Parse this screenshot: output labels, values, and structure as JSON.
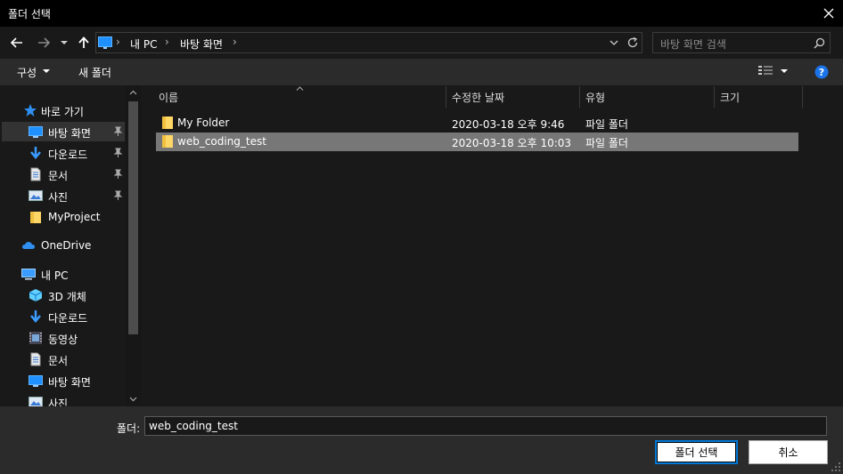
{
  "window": {
    "title": "폴더 선택",
    "close_icon": "close-icon"
  },
  "address": {
    "breadcrumbs": [
      "내 PC",
      "바탕 화면"
    ],
    "search_placeholder": "바탕 화면 검색"
  },
  "toolbar": {
    "organize_label": "구성",
    "new_folder_label": "새 폴더"
  },
  "nav": {
    "quick_access": {
      "label": "바로 가기"
    },
    "quick_items": [
      {
        "label": "바탕 화면",
        "icon": "desktop-icon",
        "pinned": true,
        "selected": true
      },
      {
        "label": "다운로드",
        "icon": "download-icon",
        "pinned": true
      },
      {
        "label": "문서",
        "icon": "document-icon",
        "pinned": true
      },
      {
        "label": "사진",
        "icon": "pictures-icon",
        "pinned": true
      },
      {
        "label": "MyProject",
        "icon": "folder-icon",
        "pinned": false
      }
    ],
    "onedrive": {
      "label": "OneDrive"
    },
    "this_pc": {
      "label": "내 PC"
    },
    "pc_items": [
      {
        "label": "3D 개체",
        "icon": "3d-objects-icon"
      },
      {
        "label": "다운로드",
        "icon": "download-icon"
      },
      {
        "label": "동영상",
        "icon": "video-icon"
      },
      {
        "label": "문서",
        "icon": "document-icon"
      },
      {
        "label": "바탕 화면",
        "icon": "desktop-icon"
      },
      {
        "label": "사진",
        "icon": "pictures-icon"
      }
    ]
  },
  "filelist": {
    "columns": [
      "이름",
      "수정한 날짜",
      "유형",
      "크기"
    ],
    "rows": [
      {
        "name": "My Folder",
        "modified": "2020-03-18 오후 9:46",
        "type": "파일 폴더",
        "selected": false
      },
      {
        "name": "web_coding_test",
        "modified": "2020-03-18 오후 10:03",
        "type": "파일 폴더",
        "selected": true
      }
    ]
  },
  "bottom": {
    "folder_label": "폴더:",
    "folder_value": "web_coding_test",
    "select_button": "폴더 선택",
    "cancel_button": "취소"
  },
  "colors": {
    "accent": "#0078d7",
    "folder": "#ffd766",
    "selection": "#777777"
  }
}
